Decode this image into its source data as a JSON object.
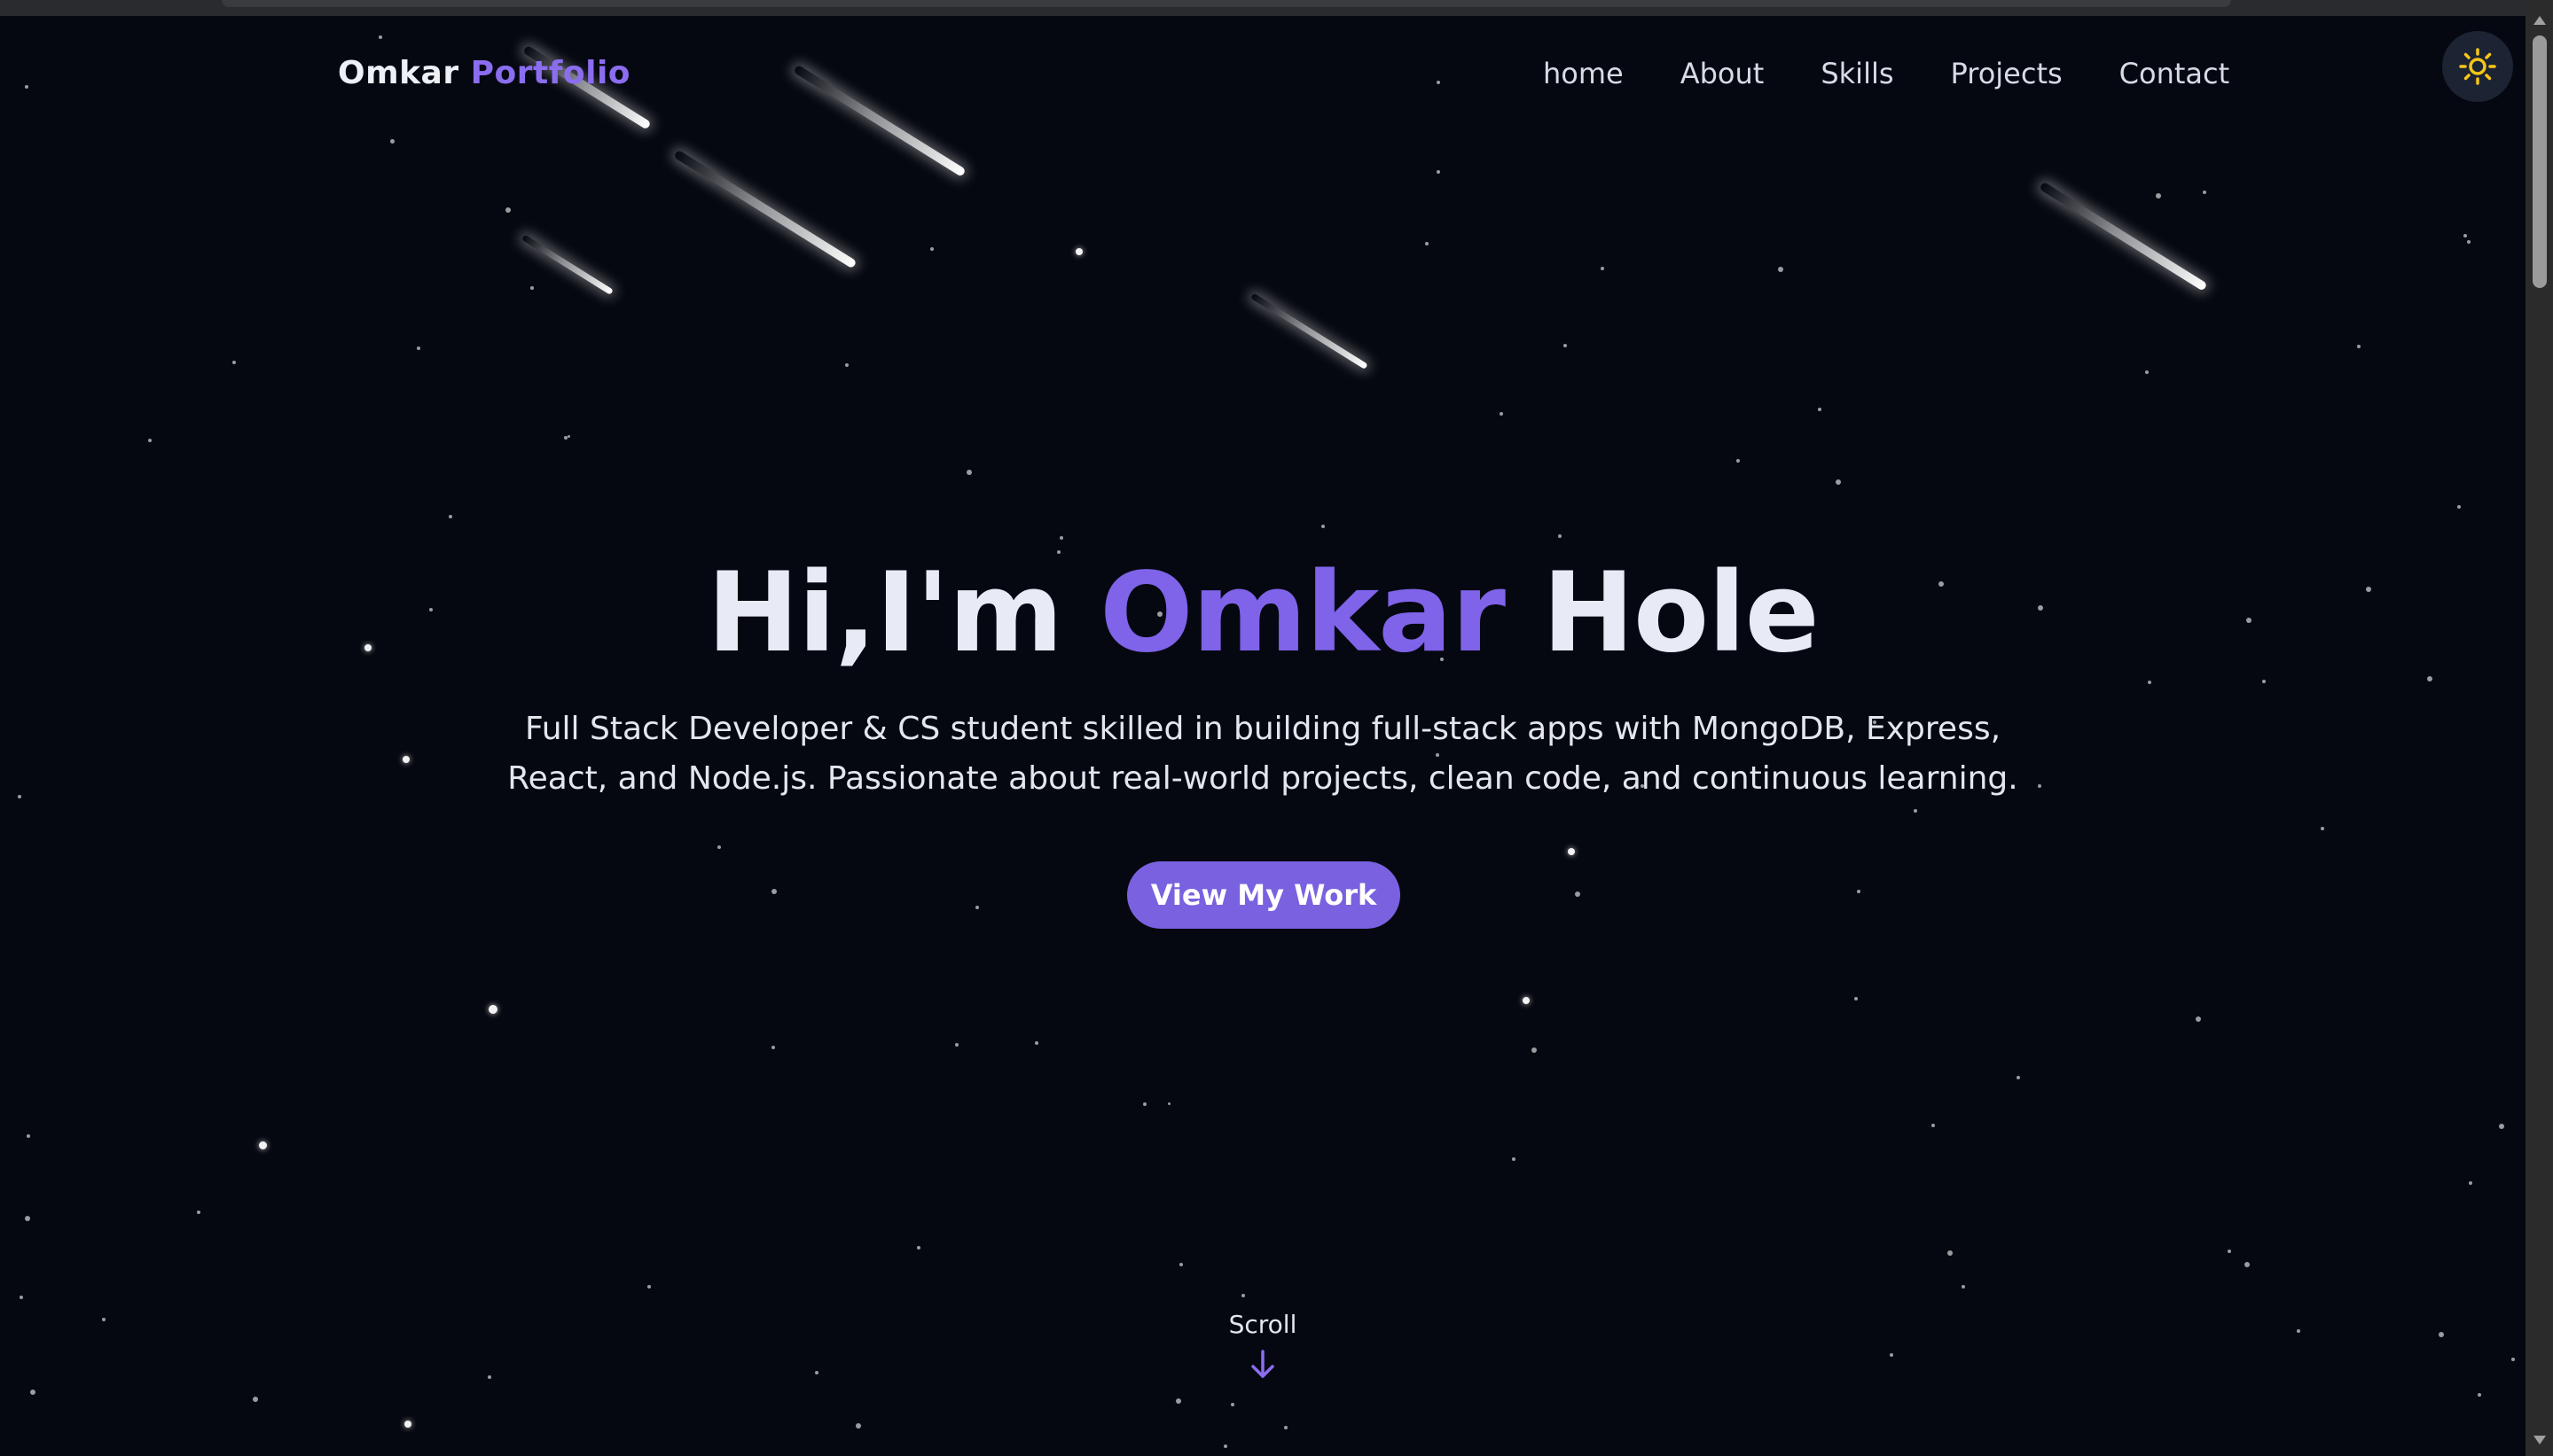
{
  "nav": {
    "brand_first": "Omkar",
    "brand_second": "Portfolio",
    "links": [
      "home",
      "About",
      "Skills",
      "Projects",
      "Contact"
    ],
    "theme_toggle_icon": "sun-icon"
  },
  "hero": {
    "greeting": "Hi,I'm",
    "first_name": "Omkar",
    "last_name": "Hole",
    "subtitle": "Full Stack Developer & CS student skilled in building full-stack apps with MongoDB, Express, React, and Node.js. Passionate about real-world projects, clean code, and continuous learning.",
    "cta_label": "View My Work",
    "scroll_label": "Scroll",
    "scroll_icon": "arrow-down-icon"
  },
  "colors": {
    "background": "#060811",
    "accent": "#7f63e8",
    "text": "#e8ebf5",
    "toggle_bg": "#1c2333",
    "sun": "#f5c518"
  }
}
